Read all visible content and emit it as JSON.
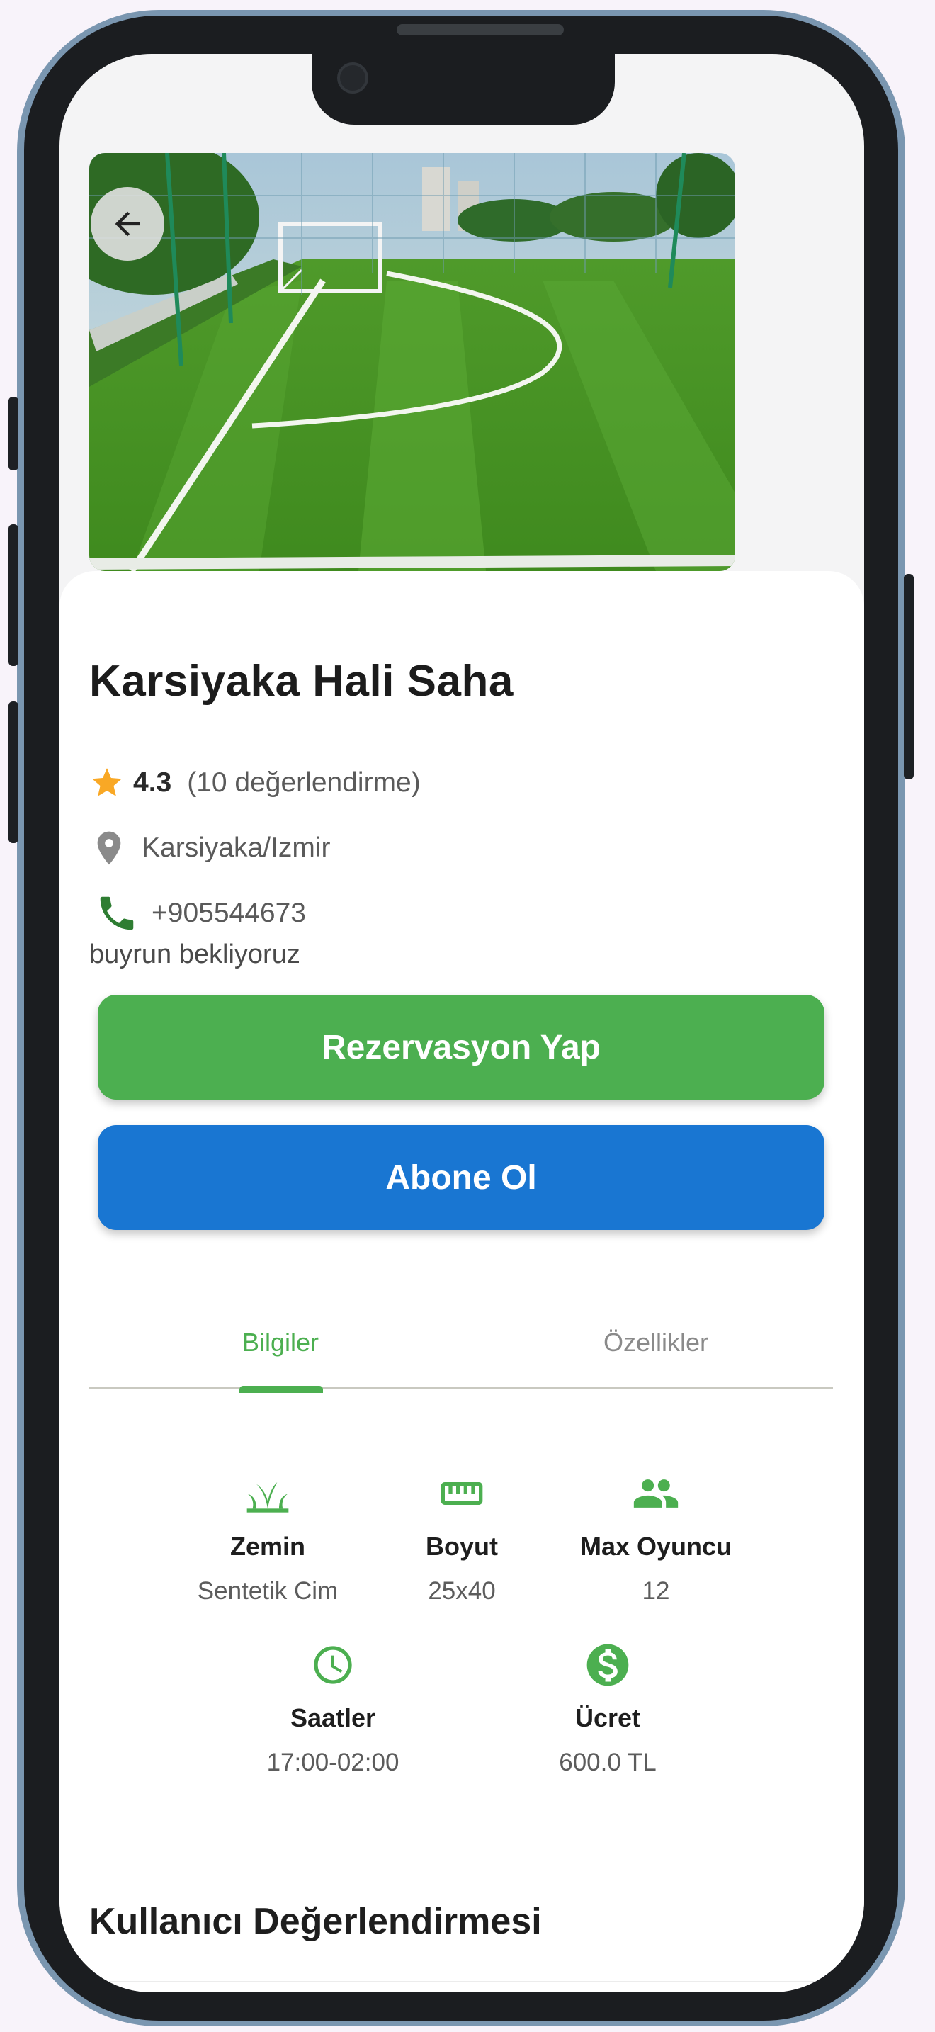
{
  "venue": {
    "name": "Karsiyaka Hali Saha",
    "rating": "4.3",
    "rating_count": "(10 değerlendirme)",
    "location": "Karsiyaka/Izmir",
    "phone": "+905544673",
    "description": "buyrun bekliyoruz"
  },
  "actions": {
    "reserve_label": "Rezervasyon Yap",
    "subscribe_label": "Abone Ol"
  },
  "tabs": [
    {
      "label": "Bilgiler",
      "active": true
    },
    {
      "label": "Özellikler",
      "active": false
    }
  ],
  "features": [
    {
      "label": "Zemin",
      "value": "Sentetik Cim",
      "icon": "grass-icon"
    },
    {
      "label": "Boyut",
      "value": "25x40",
      "icon": "ruler-icon"
    },
    {
      "label": "Max Oyuncu",
      "value": "12",
      "icon": "people-icon"
    },
    {
      "label": "Saatler",
      "value": "17:00-02:00",
      "icon": "clock-icon"
    },
    {
      "label": "Ücret",
      "value": "600.0 TL",
      "icon": "dollar-icon"
    }
  ],
  "reviews": {
    "title": "Kullanıcı Değerlendirmesi"
  },
  "colors": {
    "accent_green": "#4caf50",
    "accent_blue": "#1976d2",
    "star": "#f9a825",
    "phone_icon": "#2e7d32"
  }
}
